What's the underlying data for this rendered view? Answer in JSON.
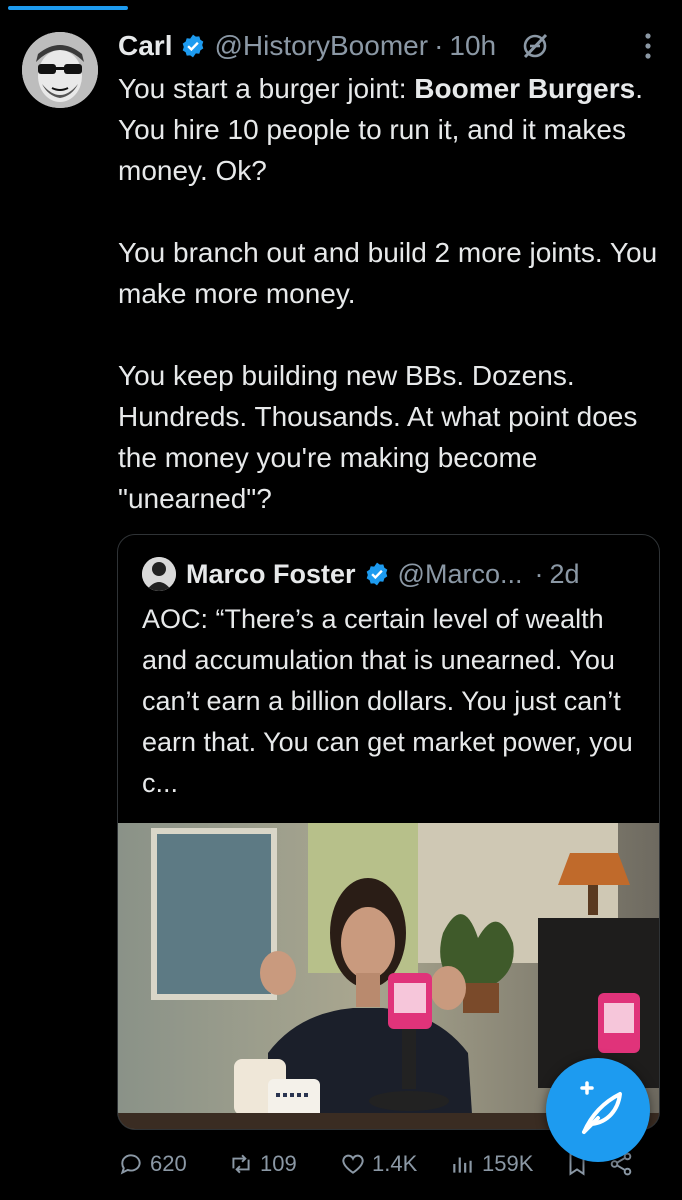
{
  "tweet": {
    "author_name": "Carl",
    "author_handle": "@HistoryBoomer",
    "separator": "·",
    "time": "10h",
    "paragraph1_pre": "You start a burger joint: ",
    "paragraph1_bold": "Boomer Burgers",
    "paragraph1_post": ". You hire 10 people to run it, and it makes money. Ok?",
    "paragraph2": "You branch out and build 2 more joints. You make more money.",
    "paragraph3": "You keep building new BBs. Dozens. Hundreds. Thousands. At what point does the money you're making become \"unearned\"?"
  },
  "quoted": {
    "author_name": "Marco Foster",
    "author_handle": "@Marco...",
    "separator": "·",
    "time": "2d",
    "text": "AOC: “There’s a certain level of wealth and accumulation that is unearned. You can’t earn a billion dollars. You just can’t earn that. You can get market power, you c..."
  },
  "actions": {
    "replies": "620",
    "reposts": "109",
    "likes": "1.4K",
    "views": "159K"
  },
  "colors": {
    "accent": "#1d9bf0",
    "muted": "#8b98a5",
    "text": "#e7e9ea",
    "background": "#000000"
  },
  "icons": [
    "verified-icon",
    "grok-icon",
    "more-icon",
    "reply-icon",
    "repost-icon",
    "like-icon",
    "views-icon",
    "bookmark-icon",
    "share-icon",
    "compose-icon"
  ]
}
